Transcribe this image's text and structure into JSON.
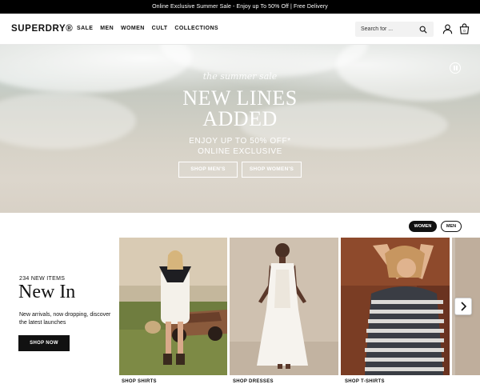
{
  "promo": {
    "text": "Online Exclusive Summer Sale - Enjoy up To 50% Off | Free Delivery"
  },
  "header": {
    "logo": "SUPERDRY®",
    "nav": [
      "SALE",
      "MEN",
      "WOMEN",
      "CULT",
      "COLLECTIONS"
    ],
    "search_placeholder": "Search for ..."
  },
  "hero": {
    "tagline": "the summer sale",
    "title_line1": "NEW LINES",
    "title_line2": "ADDED",
    "sub_line1": "ENJOY UP TO 50% OFF*",
    "sub_line2": "ONLINE EXCLUSIVE",
    "btn_men": "SHOP MEN'S",
    "btn_women": "SHOP WOMEN'S"
  },
  "toggle": {
    "women": "WOMEN",
    "men": "MEN",
    "active": "WOMEN"
  },
  "new_in": {
    "count": "234 NEW ITEMS",
    "title": "New In",
    "description": "New arrivals, now dropping, discover the latest launches",
    "cta": "SHOP NOW"
  },
  "cards": [
    {
      "label": "SHOP SHIRTS"
    },
    {
      "label": "SHOP DRESSES"
    },
    {
      "label": "SHOP T-SHIRTS"
    }
  ],
  "colors": {
    "accent": "#111111",
    "promo_bg": "#000000",
    "search_bg": "#f2f2f2"
  },
  "icons": [
    "search-icon",
    "user-icon",
    "bag-icon",
    "pause-icon",
    "chevron-right-icon"
  ]
}
